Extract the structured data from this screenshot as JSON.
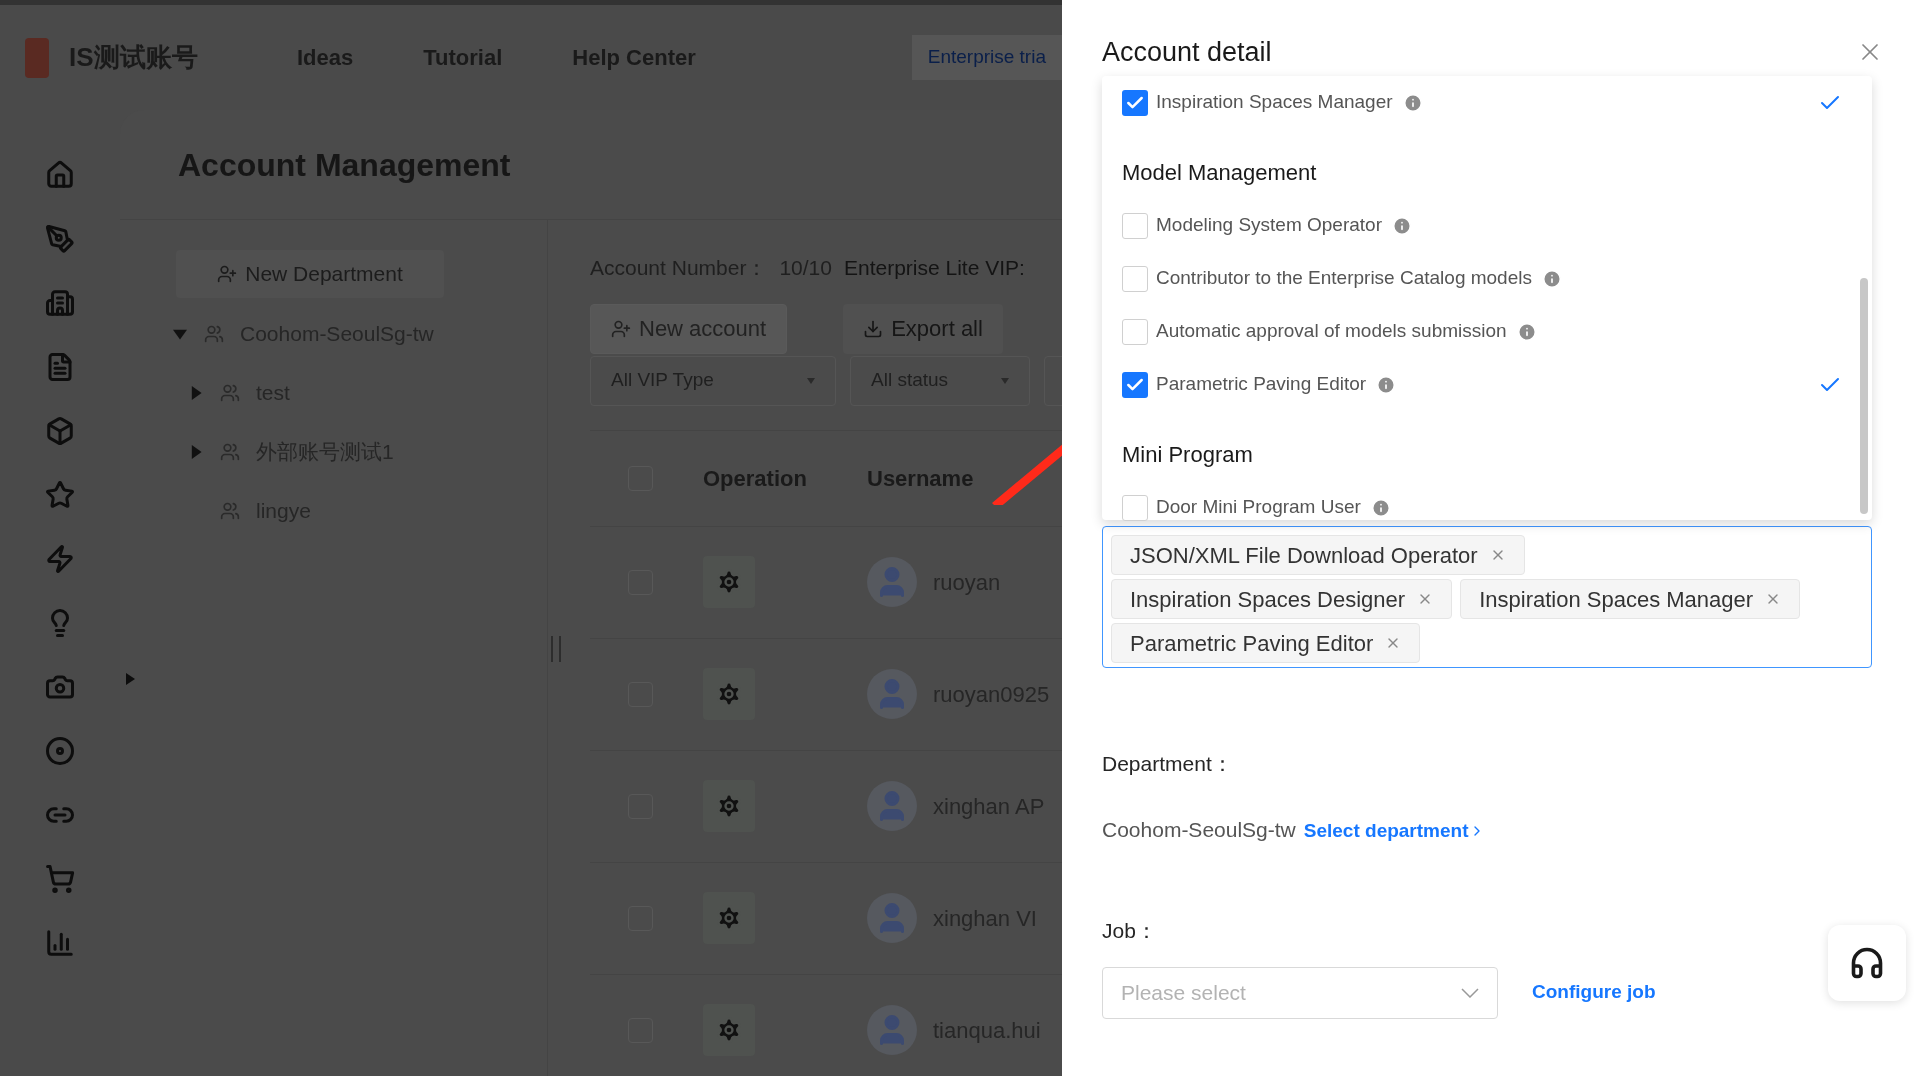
{
  "header": {
    "title": "IS测试账号",
    "nav": [
      "Ideas",
      "Tutorial",
      "Help Center"
    ],
    "trial_link": "Enterprise tria"
  },
  "page": {
    "title": "Account Management",
    "new_department": "New Department",
    "tree": [
      {
        "label": "Coohom-SeoulSg-tw",
        "kind": "folder",
        "expanded": true,
        "children": [
          {
            "label": "test",
            "kind": "folder",
            "expanded": false
          },
          {
            "label": "外部账号测试1",
            "kind": "folder",
            "expanded": false
          },
          {
            "label": "lingye",
            "kind": "leaf"
          }
        ]
      }
    ],
    "account_number": {
      "label": "Account Number：",
      "value": "10/10",
      "plan": "Enterprise Lite VIP:"
    },
    "buttons": [
      {
        "label": "New account",
        "disabled": true
      },
      {
        "label": "Export all",
        "disabled": false
      }
    ],
    "filters": [
      "All VIP Type",
      "All status"
    ],
    "table": {
      "select_all_checked": false,
      "columns": [
        "Operation",
        "Username"
      ],
      "rows": [
        {
          "username": "ruoyan",
          "checked": false
        },
        {
          "username": "ruoyan0925",
          "checked": false
        },
        {
          "username": "xinghan AP",
          "checked": false
        },
        {
          "username": "xinghan VI",
          "checked": false
        },
        {
          "username": "tianqua.hui",
          "checked": false
        }
      ]
    }
  },
  "drawer": {
    "title": "Account detail",
    "permissions": [
      {
        "kind": "option",
        "label": "Inspiration Spaces Manager",
        "checked": true
      },
      {
        "kind": "heading",
        "label": "Model Management"
      },
      {
        "kind": "option",
        "label": "Modeling System Operator",
        "checked": false
      },
      {
        "kind": "option",
        "label": "Contributor to the Enterprise Catalog models",
        "checked": false
      },
      {
        "kind": "option",
        "label": "Automatic approval of models submission",
        "checked": false
      },
      {
        "kind": "option",
        "label": "Parametric Paving Editor",
        "checked": true
      },
      {
        "kind": "heading",
        "label": "Mini Program"
      },
      {
        "kind": "option",
        "label": "Door Mini Program User",
        "checked": false
      }
    ],
    "tags": [
      "JSON/XML File Download Operator",
      "Inspiration Spaces Designer",
      "Inspiration Spaces Manager",
      "Parametric Paving Editor"
    ],
    "department": {
      "label": "Department：",
      "value": "Coohom-SeoulSg-tw",
      "link": "Select department"
    },
    "job": {
      "label": "Job：",
      "placeholder": "Please select",
      "link": "Configure job"
    }
  }
}
